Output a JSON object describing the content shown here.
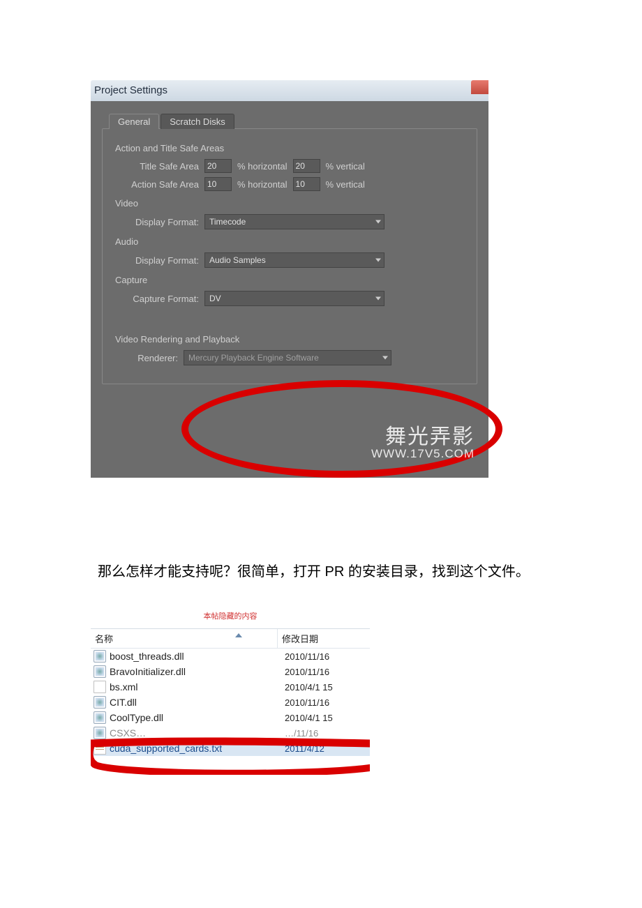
{
  "project_settings": {
    "window_title": "Project Settings",
    "tabs": {
      "general": "General",
      "scratch": "Scratch Disks"
    },
    "safe_areas": {
      "legend": "Action and Title Safe Areas",
      "title_label": "Title Safe Area",
      "action_label": "Action Safe Area",
      "title_h": "20",
      "title_v": "20",
      "action_h": "10",
      "action_v": "10",
      "pct_horiz": "% horizontal",
      "pct_vert": "% vertical"
    },
    "video": {
      "legend": "Video",
      "label": "Display Format:",
      "value": "Timecode"
    },
    "audio": {
      "legend": "Audio",
      "label": "Display Format:",
      "value": "Audio Samples"
    },
    "capture": {
      "legend": "Capture",
      "label": "Capture Format:",
      "value": "DV"
    },
    "rendering": {
      "legend": "Video Rendering and Playback",
      "label": "Renderer:",
      "value": "Mercury Playback Engine Software"
    },
    "watermark": {
      "line1": "舞光弄影",
      "line2": "WWW.17V5.COM"
    }
  },
  "paragraph": "那么怎样才能支持呢？很简单，打开 PR 的安装目录，找到这个文件。",
  "file_list": {
    "hidden_label": "本帖隐藏的内容",
    "col_name": "名称",
    "col_date": "修改日期",
    "rows": [
      {
        "icon": "dll",
        "name": "boost_threads.dll",
        "date": "2010/11/16"
      },
      {
        "icon": "dll",
        "name": "BravoInitializer.dll",
        "date": "2010/11/16"
      },
      {
        "icon": "xml",
        "name": "bs.xml",
        "date": "2010/4/1 15"
      },
      {
        "icon": "dll",
        "name": "CIT.dll",
        "date": "2010/11/16"
      },
      {
        "icon": "dll",
        "name": "CoolType.dll",
        "date": "2010/4/1 15"
      },
      {
        "icon": "dll",
        "name": "CSXS…",
        "date": "…/11/16",
        "dim": true
      },
      {
        "icon": "txt",
        "name": "cuda_supported_cards.txt",
        "date": "2011/4/12",
        "sel": true
      }
    ]
  }
}
